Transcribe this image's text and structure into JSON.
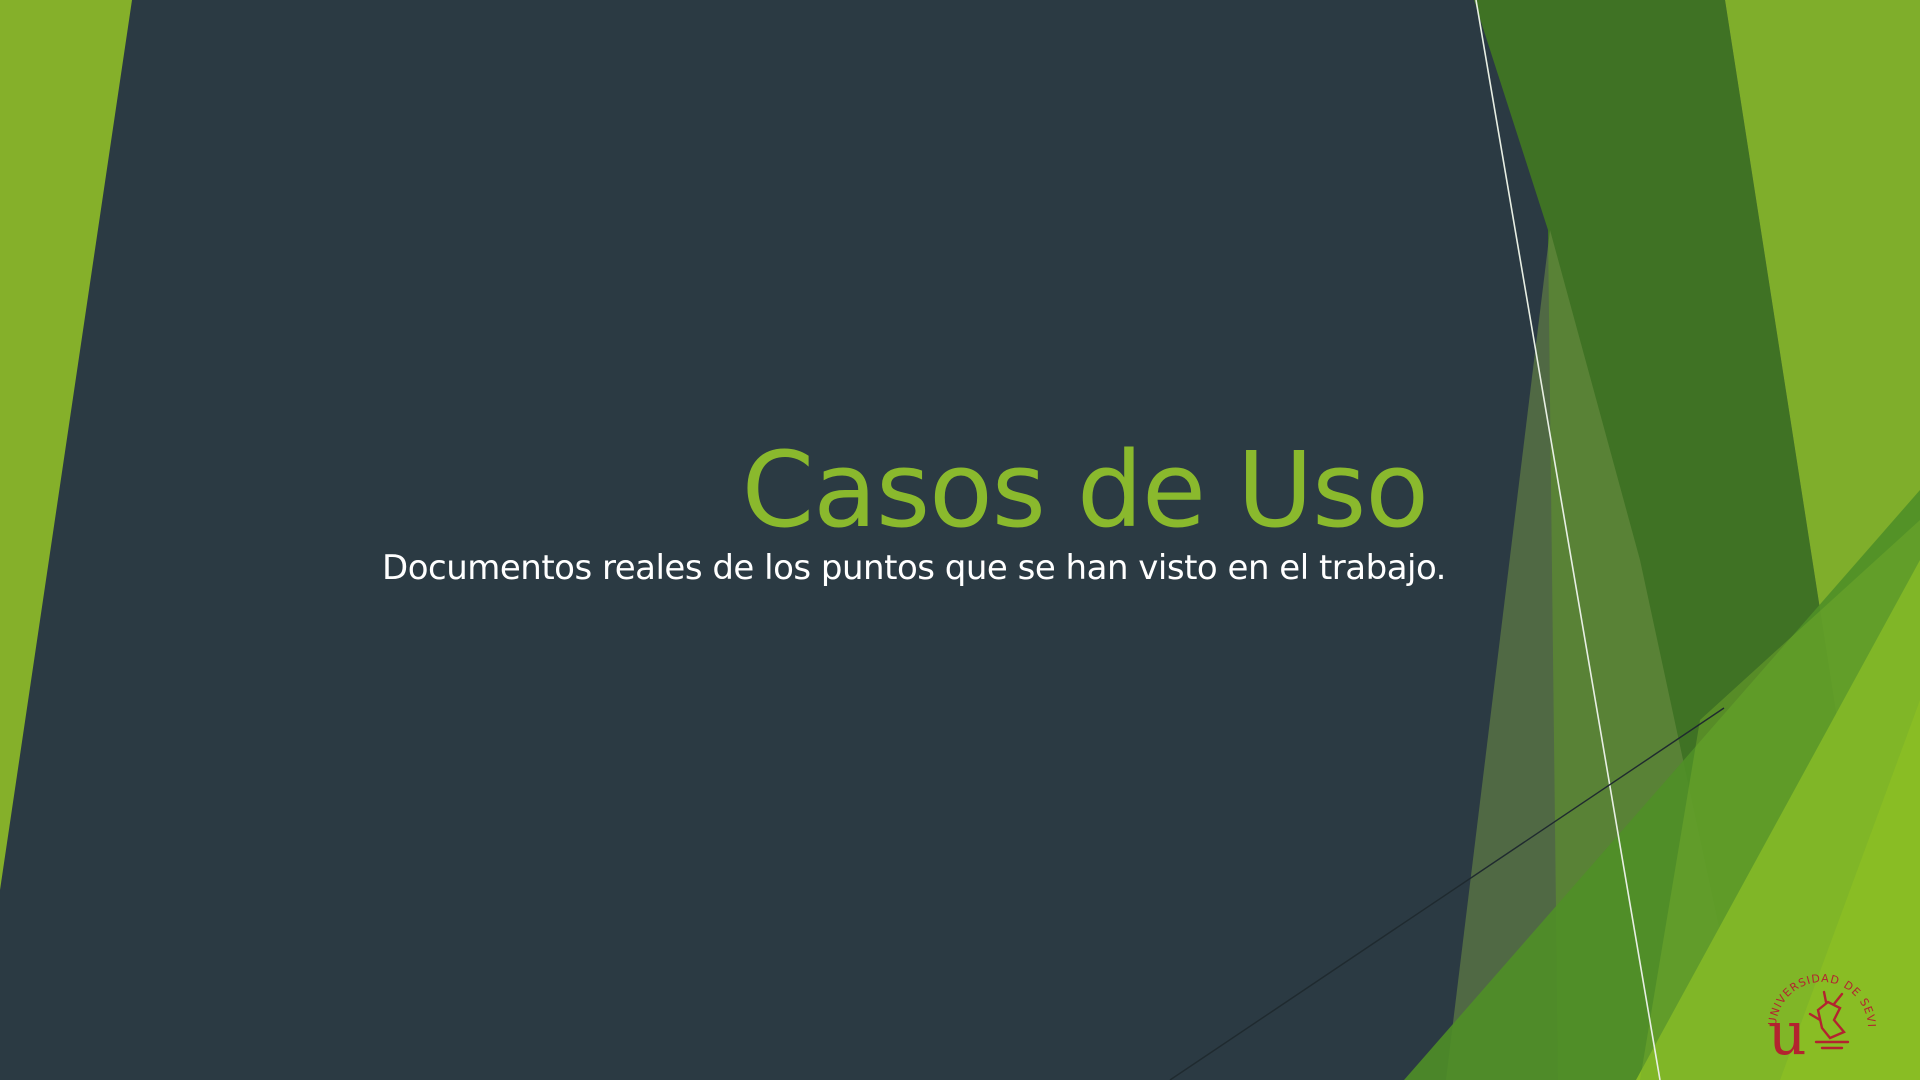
{
  "slide": {
    "title": "Casos de Uso",
    "subtitle": "Documentos reales de los puntos que se han visto en el trabajo."
  },
  "logo": {
    "ring_text": "UNIVERSIDAD DE SEVILLA",
    "monogram": "u",
    "icon": "universidad-de-sevilla-seal"
  },
  "colors": {
    "background": "#2b3a43",
    "accent_green": "#8ab92d",
    "dark_green": "#3f7224",
    "mid_green": "#4f8f27",
    "logo_red": "#b3232f",
    "subtitle": "#ffffff"
  }
}
